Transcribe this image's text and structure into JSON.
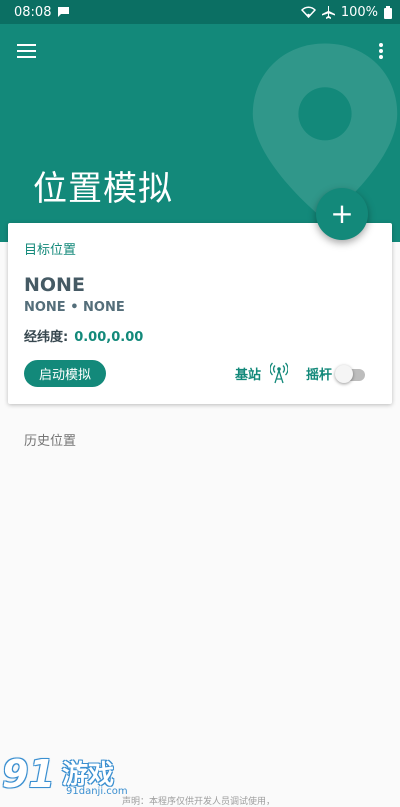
{
  "status_bar": {
    "time": "08:08",
    "battery": "100%",
    "icons": [
      "message-icon",
      "wifi-icon",
      "airplane-icon",
      "battery-icon"
    ]
  },
  "app": {
    "title": "位置模拟",
    "fab_label": "+",
    "colors": {
      "primary": "#13897a",
      "status_bar": "#0b6f63",
      "background": "#fafafa"
    }
  },
  "target_card": {
    "section_label": "目标位置",
    "location_name": "NONE",
    "location_sub": "NONE • NONE",
    "coord_label": "经纬度:",
    "coord_value": "0.00,0.00",
    "start_button": "启动模拟",
    "base_station_label": "基站",
    "joystick_label": "摇杆",
    "joystick_enabled": false
  },
  "history": {
    "label": "历史位置"
  },
  "footer": {
    "logo_number": "91",
    "logo_text": "游戏",
    "logo_domain": "91danji.com",
    "disclaimer": "声明：本程序仅供开发人员调试使用，"
  }
}
